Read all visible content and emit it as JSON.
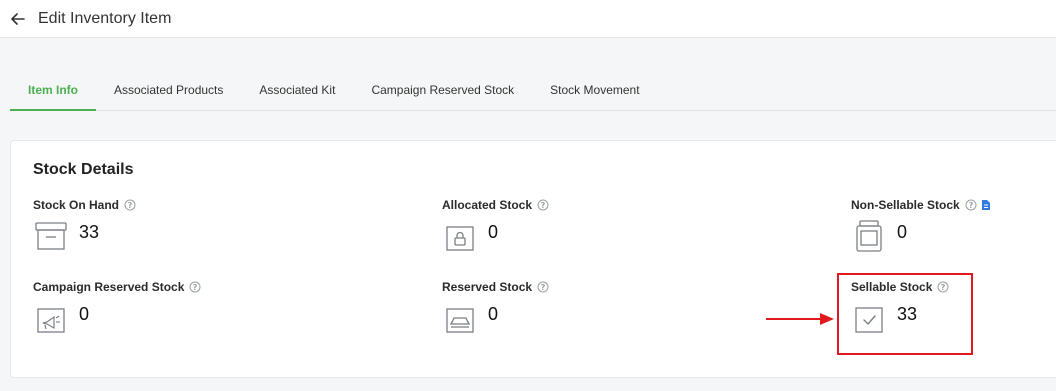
{
  "header": {
    "title": "Edit Inventory Item",
    "back_icon": "arrow-left-icon"
  },
  "tabs": [
    {
      "label": "Item Info",
      "active": true
    },
    {
      "label": "Associated Products",
      "active": false
    },
    {
      "label": "Associated Kit",
      "active": false
    },
    {
      "label": "Campaign Reserved Stock",
      "active": false
    },
    {
      "label": "Stock Movement",
      "active": false
    }
  ],
  "stock_details": {
    "title": "Stock Details",
    "stock_on_hand": {
      "label": "Stock On Hand",
      "value": "33",
      "icon": "box-icon"
    },
    "allocated_stock": {
      "label": "Allocated Stock",
      "value": "0",
      "icon": "locked-box-icon"
    },
    "non_sellable_stock": {
      "label": "Non-Sellable Stock",
      "value": "0",
      "icon": "jar-icon",
      "extra_icon": "document-icon"
    },
    "campaign_reserved_stock": {
      "label": "Campaign Reserved Stock",
      "value": "0",
      "icon": "megaphone-icon"
    },
    "reserved_stock": {
      "label": "Reserved Stock",
      "value": "0",
      "icon": "reserved-tray-icon"
    },
    "sellable_stock": {
      "label": "Sellable Stock",
      "value": "33",
      "icon": "check-box-icon"
    }
  },
  "colors": {
    "accent": "#4caf50",
    "highlight": "#e0191f",
    "doc_icon": "#2f7de1"
  }
}
